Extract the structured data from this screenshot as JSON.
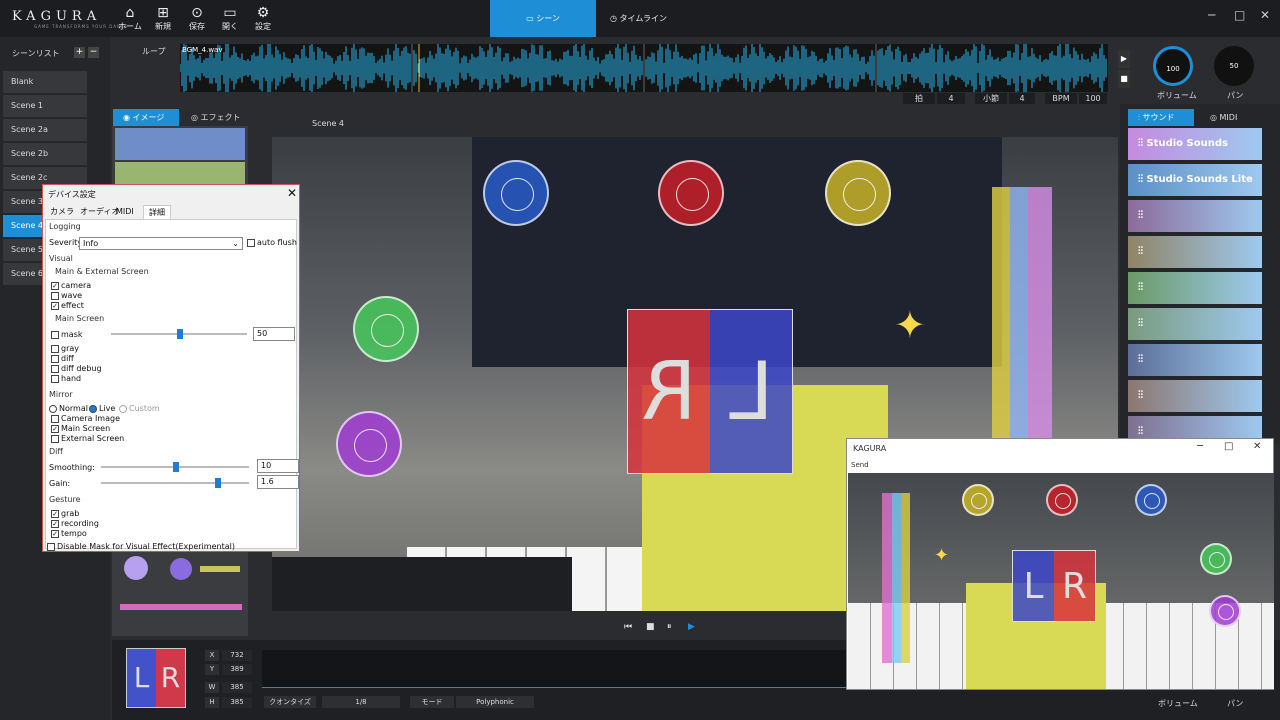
{
  "app": {
    "logo": "KAGURA",
    "logo_sub": "GAME TRANSFORMS YOUR DANCE"
  },
  "toolbar": {
    "home": "ホーム",
    "new": "新規",
    "save": "保存",
    "open": "開く",
    "settings": "設定"
  },
  "mode_tabs": {
    "scene": "シーン",
    "timeline": "タイムライン"
  },
  "scene_list": {
    "title": "シーンリスト",
    "items": [
      "Blank",
      "Scene 1",
      "Scene 2a",
      "Scene 2b",
      "Scene 2c",
      "Scene 3",
      "Scene 4",
      "Scene 5",
      "Scene 6"
    ],
    "active_index": 6
  },
  "loop": {
    "label": "ループ",
    "file": "BGM_4.wav"
  },
  "beat": {
    "beat_label": "拍",
    "beat_value": "4",
    "bar_label": "小節",
    "bar_value": "4",
    "bpm_label": "BPM",
    "bpm_value": "100"
  },
  "knobs": {
    "volume_value": "100",
    "volume_label": "ボリューム",
    "pan_value": "50",
    "pan_label": "パン"
  },
  "image_tabs": {
    "image": "イメージ",
    "effect": "エフェクト"
  },
  "scene_title": "Scene 4",
  "sound_tabs": {
    "sound": "サウンド",
    "midi": "MIDI"
  },
  "sounds": [
    {
      "name": "Studio Sounds",
      "color": "#c58ae0"
    },
    {
      "name": "Studio Sounds Lite",
      "color": "#5b8fc6"
    },
    {
      "name": "",
      "color": "#8c6b9a"
    },
    {
      "name": "",
      "color": "#8f8466"
    },
    {
      "name": "",
      "color": "#6b9a66"
    },
    {
      "name": "",
      "color": "#7a9a7e"
    },
    {
      "name": "",
      "color": "#5c6e98"
    },
    {
      "name": "",
      "color": "#8c7670"
    },
    {
      "name": "",
      "color": "#7f7090"
    }
  ],
  "lr": {
    "l": "L",
    "r": "R"
  },
  "dialog": {
    "title": "デバイス設定",
    "tabs": [
      "カメラ",
      "オーディオ",
      "MIDI",
      "詳細"
    ],
    "logging": "Logging",
    "severity_label": "Severity:",
    "severity_value": "Info",
    "auto_flush": "auto flush",
    "visual": "Visual",
    "main_external": "Main & External Screen",
    "camera": "camera",
    "wave": "wave",
    "effect": "effect",
    "main_screen": "Main Screen",
    "mask": "mask",
    "mask_value": "50",
    "gray": "gray",
    "diff": "diff",
    "diff_debug": "diff debug",
    "hand": "hand",
    "mirror": "Mirror",
    "normal": "Normal",
    "live": "Live",
    "custom": "Custom",
    "camera_image": "Camera Image",
    "main_screen_cb": "Main Screen",
    "external_screen": "External Screen",
    "diff_sect": "Diff",
    "smoothing": "Smoothing:",
    "smoothing_value": "10",
    "gain": "Gain:",
    "gain_value": "1.6",
    "gesture": "Gesture",
    "grab": "grab",
    "recording": "recording",
    "tempo": "tempo",
    "disable_mask": "Disable Mask for Visual Effect(Experimental)"
  },
  "coords": {
    "x_label": "X",
    "x": "732",
    "y_label": "Y",
    "y": "389",
    "w_label": "W",
    "w": "385",
    "h_label": "H",
    "h": "385"
  },
  "bottom": {
    "quantize_label": "クオンタイズ",
    "quantize_value": "1/8",
    "mode_label": "モード",
    "mode_value": "Polyphonic"
  },
  "kagura_window": {
    "title": "KAGURA",
    "menu": "Send"
  }
}
